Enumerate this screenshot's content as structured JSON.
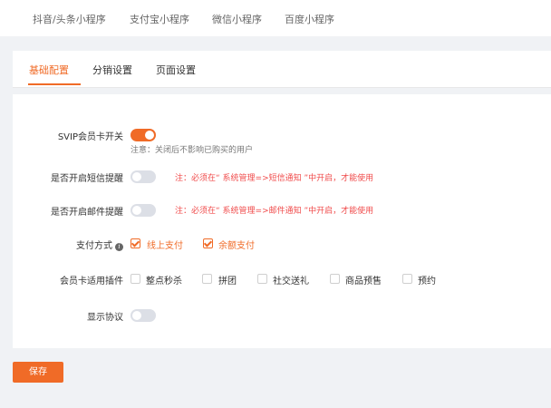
{
  "platform_tabs": [
    "抖音/头条小程序",
    "支付宝小程序",
    "微信小程序",
    "百度小程序"
  ],
  "config_tabs": [
    "基础配置",
    "分销设置",
    "页面设置"
  ],
  "form": {
    "svip": {
      "label": "SVIP会员卡开关",
      "enabled": true,
      "note": "注意：关闭后不影响已购买的用户"
    },
    "sms": {
      "label": "是否开启短信提醒",
      "enabled": false,
      "hint": "注：必须在“ 系统管理=>短信通知 ”中开启，才能使用"
    },
    "mail": {
      "label": "是否开启邮件提醒",
      "enabled": false,
      "hint": "注：必须在“ 系统管理=>邮件通知 ”中开启，才能使用"
    },
    "payment": {
      "label": "支付方式",
      "options": [
        {
          "label": "线上支付",
          "checked": true
        },
        {
          "label": "余额支付",
          "checked": true
        }
      ]
    },
    "plugins": {
      "label": "会员卡适用插件",
      "options": [
        {
          "label": "整点秒杀",
          "checked": false
        },
        {
          "label": "拼团",
          "checked": false
        },
        {
          "label": "社交送礼",
          "checked": false
        },
        {
          "label": "商品预售",
          "checked": false
        },
        {
          "label": "预约",
          "checked": false
        }
      ]
    },
    "agreement": {
      "label": "显示协议",
      "enabled": false
    }
  },
  "save_label": "保存",
  "colors": {
    "accent": "#f06b27",
    "hint_red": "#f04c4c",
    "background": "#f0f2f5"
  }
}
